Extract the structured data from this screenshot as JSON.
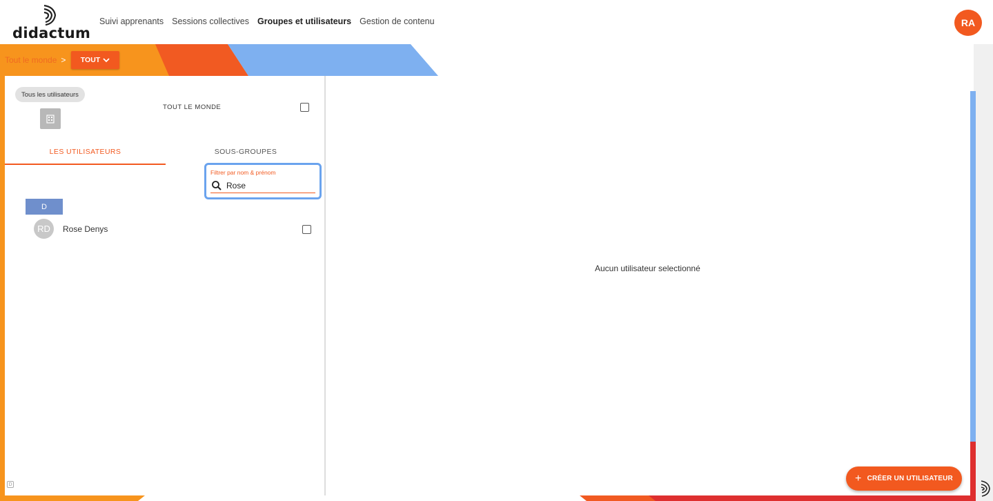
{
  "app": {
    "logo_text": "didactum"
  },
  "nav": {
    "items": [
      {
        "label": "Suivi apprenants"
      },
      {
        "label": "Sessions collectives"
      },
      {
        "label": "Groupes et utilisateurs"
      },
      {
        "label": "Gestion de contenu"
      }
    ]
  },
  "profile": {
    "initials": "RA"
  },
  "breadcrumb": {
    "root": "Tout le monde",
    "separator": ">",
    "current": "TOUT"
  },
  "left": {
    "chip": "Tous les utilisateurs",
    "everyone_label": "TOUT LE MONDE",
    "tabs": {
      "users": "LES UTILISATEURS",
      "subgroups": "SOUS-GROUPES"
    },
    "search": {
      "label": "Filtrer par nom & prénom",
      "value": "Rose"
    },
    "letter": "D",
    "user": {
      "initials": "RD",
      "name": "Rose Denys"
    },
    "footer_icon": "D"
  },
  "right": {
    "empty_message": "Aucun utilisateur selectionné"
  },
  "actions": {
    "create_user": "CRÉER UN UTILISATEUR",
    "create_icon": "+"
  },
  "colors": {
    "accent": "#f2591f",
    "banner_orange": "#f7941d",
    "banner_blue": "#7eb0f0",
    "letter_header": "#6f8fcc",
    "focus_ring": "#6aa3ee"
  }
}
